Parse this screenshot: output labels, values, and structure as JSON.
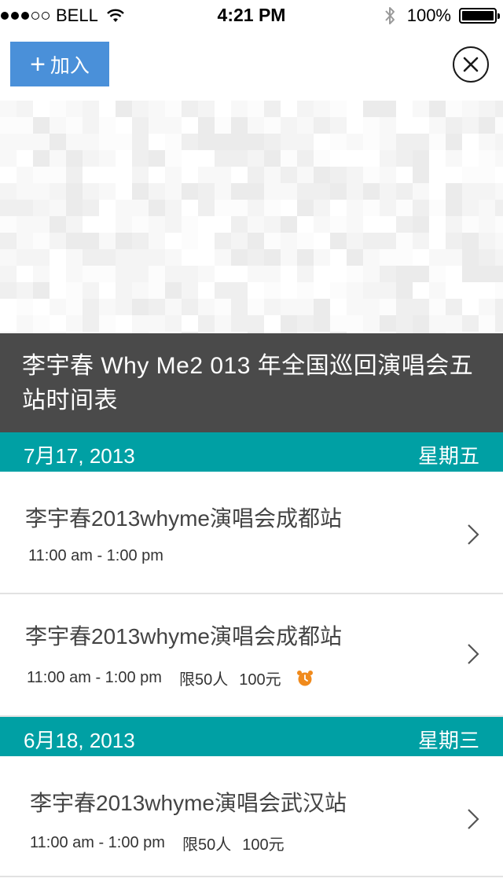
{
  "status_bar": {
    "carrier": "BELL",
    "time": "4:21 PM",
    "battery": "100%"
  },
  "toolbar": {
    "add_label": "加入"
  },
  "event": {
    "title": "李宇春 Why Me2 013 年全国巡回演唱会五站时间表"
  },
  "sections": [
    {
      "date": "7月17, 2013",
      "weekday": "星期五",
      "items": [
        {
          "name": "李宇春2013whyme演唱会成都站",
          "time": "11:00 am - 1:00 pm"
        },
        {
          "name": "李宇春2013whyme演唱会成都站",
          "time": "11:00 am - 1:00 pm",
          "limit": "限50人",
          "price": "100元"
        }
      ]
    },
    {
      "date": "6月18, 2013",
      "weekday": "星期三",
      "items": [
        {
          "name": "李宇春2013whyme演唱会武汉站",
          "time": "11:00 am - 1:00 pm",
          "limit": "限50人",
          "price": "100元"
        }
      ]
    }
  ],
  "colors": {
    "accent_teal": "#00a0a4",
    "add_button_blue": "#4a90d9",
    "title_bar": "#4a4a4a",
    "alarm_orange": "#f08a1c"
  },
  "icons": {
    "add": "plus-icon",
    "close": "close-circle-icon",
    "row": "chevron-right-icon",
    "reminder": "alarm-clock-icon"
  }
}
